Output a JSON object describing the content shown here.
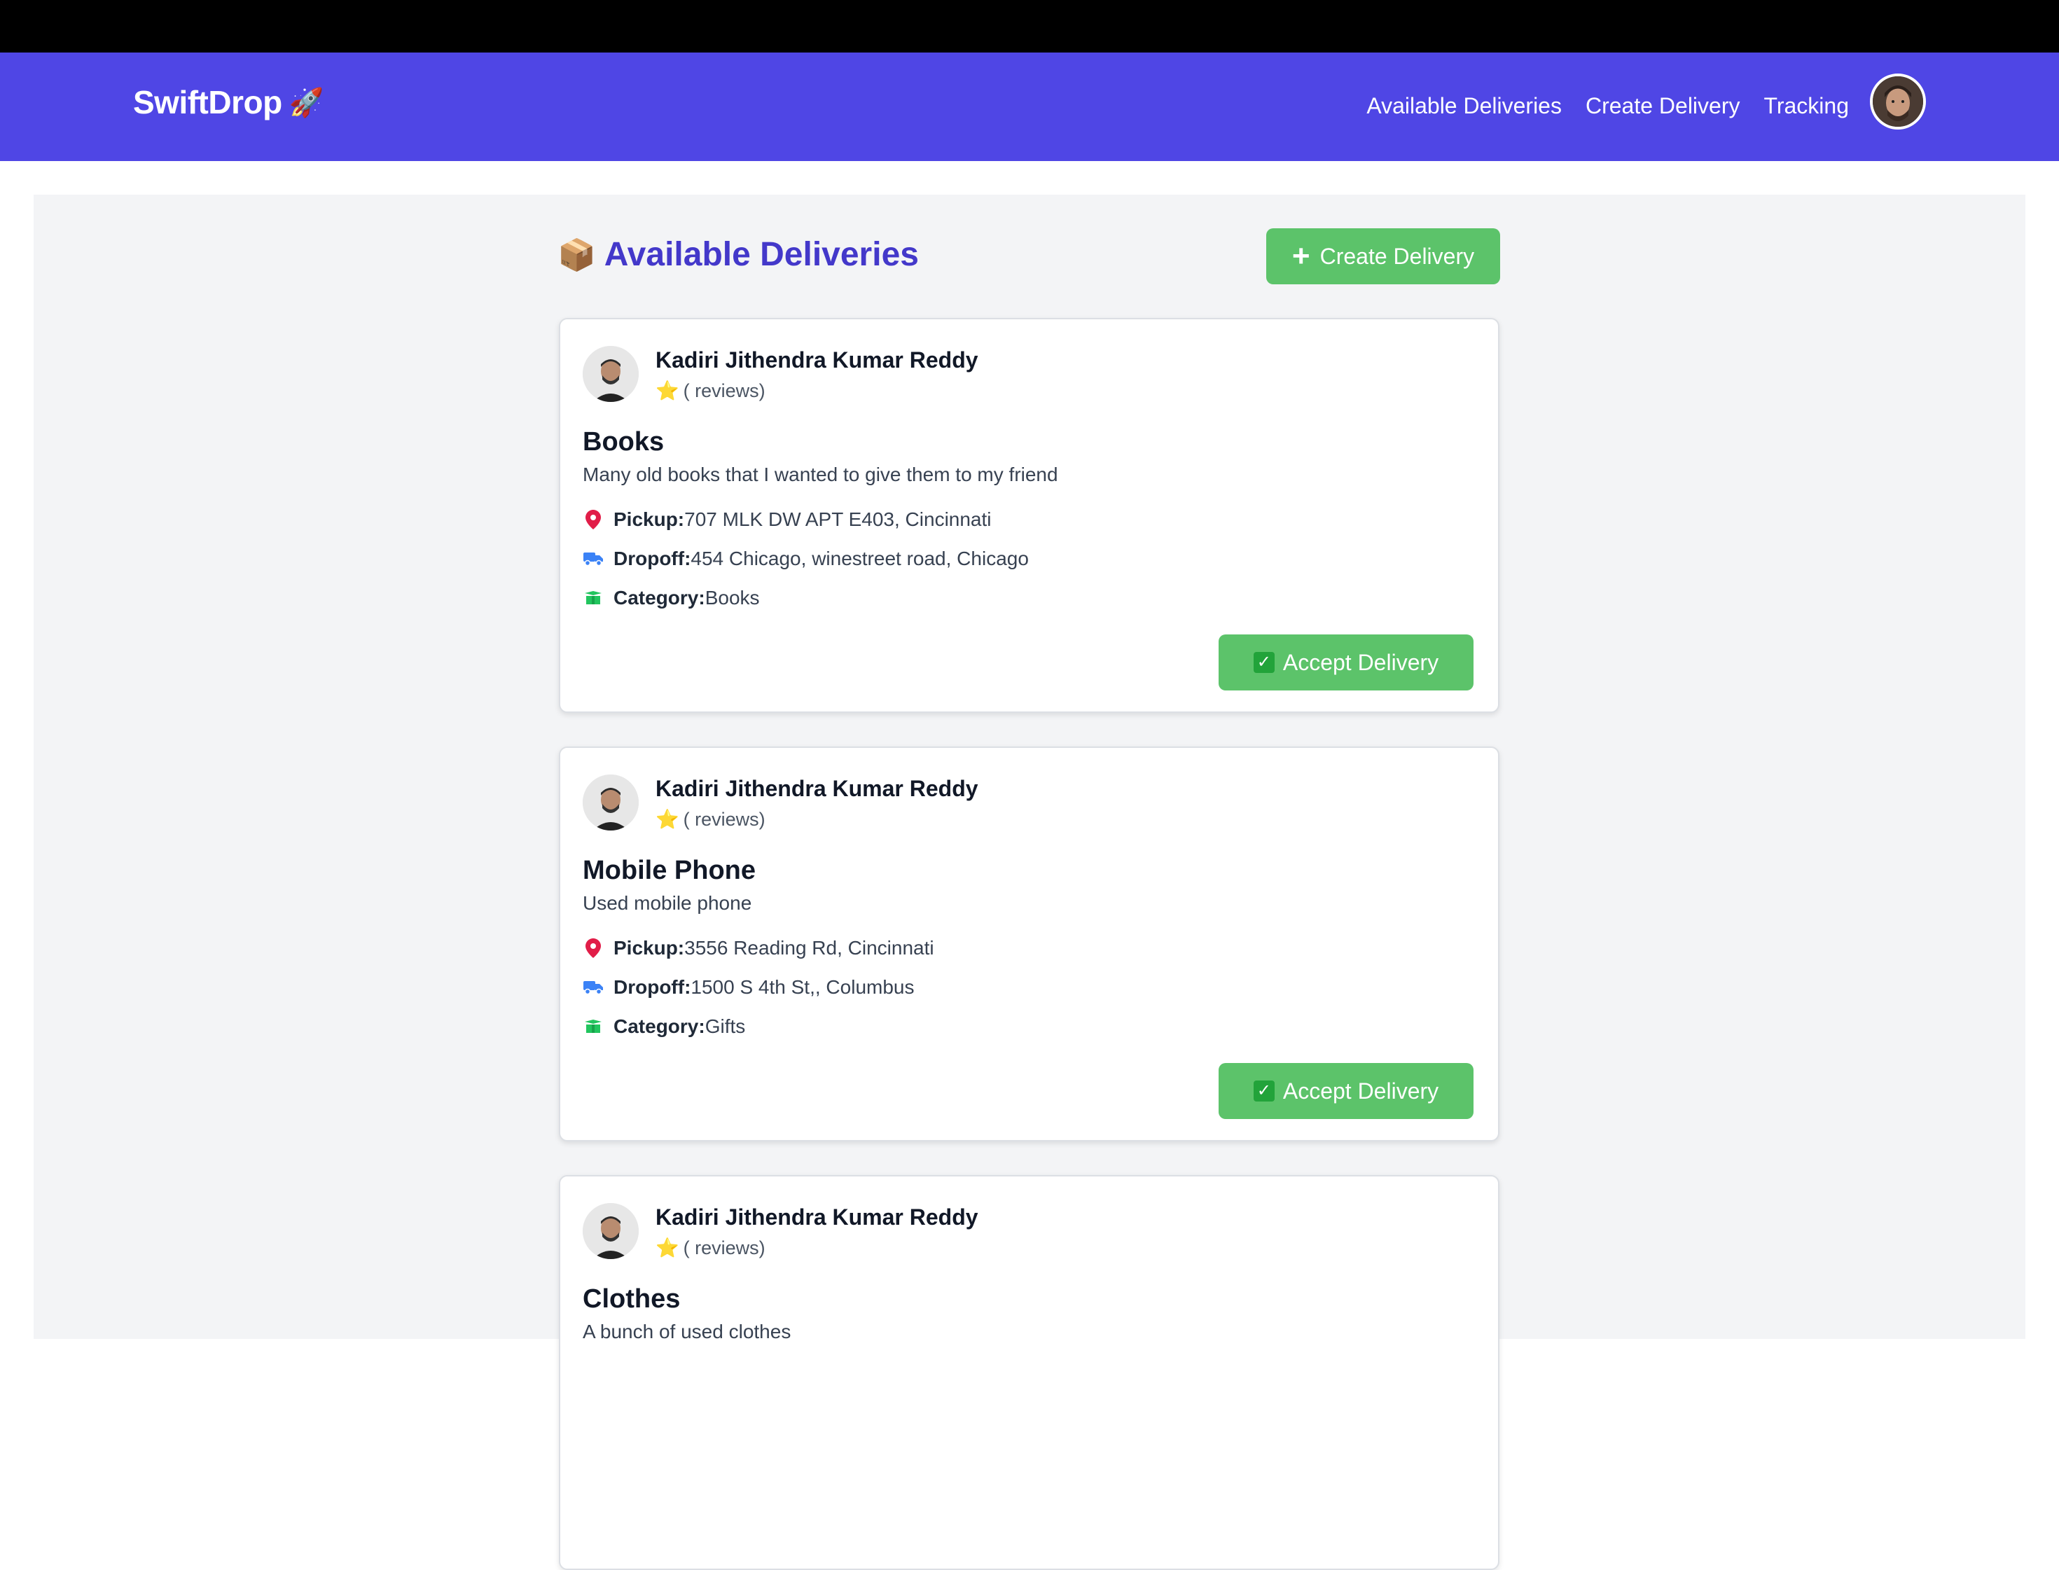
{
  "app": {
    "brand": "SwiftDrop",
    "brand_icon": "rocket"
  },
  "nav": {
    "links": [
      "Available Deliveries",
      "Create Delivery",
      "Tracking"
    ]
  },
  "page": {
    "title": "Available Deliveries",
    "title_icon": "package",
    "create_button": "Create Delivery"
  },
  "labels": {
    "pickup": "Pickup:",
    "dropoff": "Dropoff:",
    "category": "Category:",
    "accept": "Accept Delivery"
  },
  "colors": {
    "brand": "#4f46e5",
    "title": "#4338ca",
    "button": "#5cc36a",
    "pickup_icon": "#e11d48",
    "dropoff_icon": "#3b82f6",
    "category_icon": "#22c55e"
  },
  "cards": [
    {
      "user": "Kadiri Jithendra Kumar Reddy",
      "rating": "( reviews)",
      "title": "Books",
      "description": "Many old books that I wanted to give them to my friend",
      "pickup": "707 MLK DW APT E403, Cincinnati",
      "dropoff": "454 Chicago, winestreet road, Chicago",
      "category": "Books"
    },
    {
      "user": "Kadiri Jithendra Kumar Reddy",
      "rating": "( reviews)",
      "title": "Mobile Phone",
      "description": "Used mobile phone",
      "pickup": "3556 Reading Rd, Cincinnati",
      "dropoff": "1500 S 4th St,, Columbus",
      "category": "Gifts"
    },
    {
      "user": "Kadiri Jithendra Kumar Reddy",
      "rating": "( reviews)",
      "title": "Clothes",
      "description": "A bunch of used clothes"
    }
  ]
}
